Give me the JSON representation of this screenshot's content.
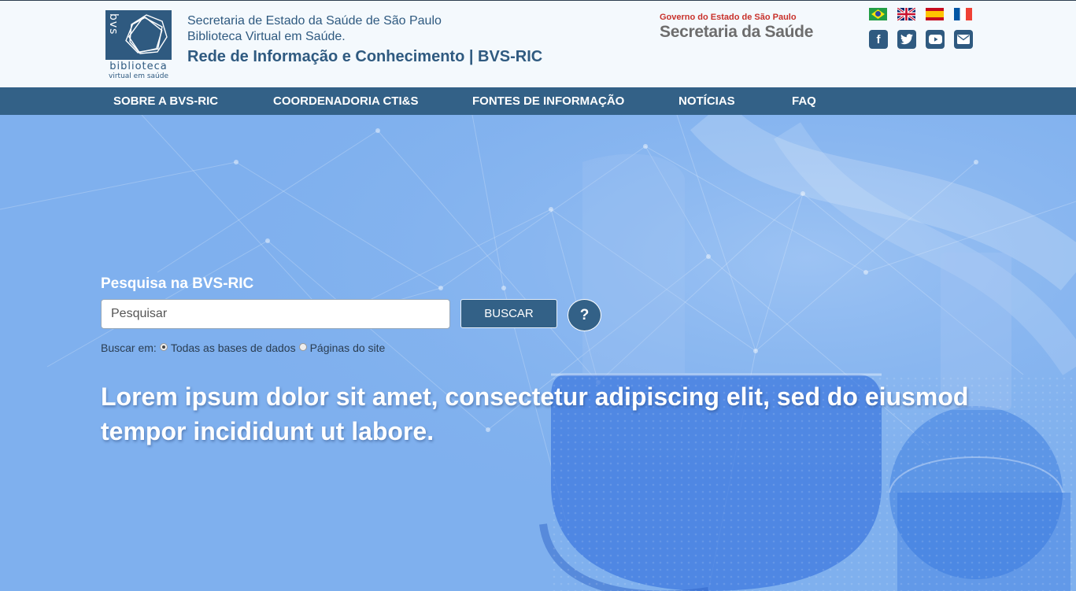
{
  "header": {
    "logo": {
      "mark": "bvs",
      "line1": "biblioteca",
      "line2": "virtual em saúde"
    },
    "org": {
      "line1": "Secretaria de Estado da Saúde de São Paulo",
      "line2": "Biblioteca Virtual em Saúde.",
      "line3": "Rede de Informação e Conhecimento | BVS-RIC"
    },
    "gov": {
      "line1": "Governo do Estado de São Paulo",
      "line2": "Secretaria da Saúde"
    },
    "languages": [
      "pt-BR",
      "en",
      "es",
      "fr"
    ],
    "social": [
      {
        "icon": "facebook-icon",
        "glyph": "f"
      },
      {
        "icon": "twitter-icon",
        "glyph": "t"
      },
      {
        "icon": "youtube-icon",
        "glyph": "▶"
      },
      {
        "icon": "email-icon",
        "glyph": "✉"
      }
    ]
  },
  "nav": {
    "items": [
      {
        "label": "SOBRE A BVS-RIC"
      },
      {
        "label": "COORDENADORIA CTI&S"
      },
      {
        "label": "FONTES DE INFORMAÇÃO"
      },
      {
        "label": "NOTÍCIAS"
      },
      {
        "label": "FAQ"
      }
    ]
  },
  "search": {
    "title": "Pesquisa na BVS-RIC",
    "placeholder": "Pesquisar",
    "button": "BUSCAR",
    "help": "?",
    "scope_label": "Buscar em:",
    "options": [
      {
        "label": "Todas as bases de dados",
        "checked": true
      },
      {
        "label": "Páginas do site",
        "checked": false
      }
    ]
  },
  "hero": {
    "lead": "Lorem ipsum dolor sit amet, consectetur adipiscing elit, sed do eiusmod tempor incididunt ut labore."
  },
  "colors": {
    "primary": "#336187",
    "header_bg": "#f4f9fd",
    "hero_bg": "#7fb0ee",
    "gov_red": "#c8312b"
  }
}
